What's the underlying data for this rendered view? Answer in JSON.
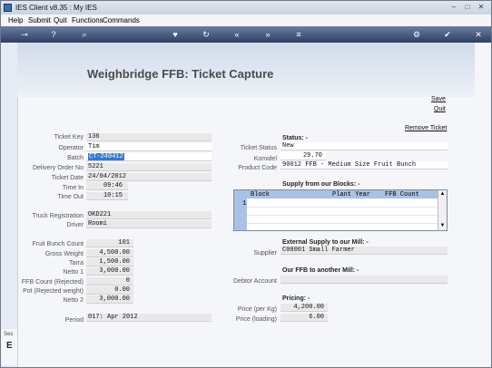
{
  "window": {
    "title": "IES Client v8.35 : My IES",
    "min": "–",
    "max": "□",
    "close": "✕"
  },
  "menu": {
    "help": "Help",
    "submit": "Submit",
    "quit": "Quit",
    "functions": "Functions",
    "commands": "Commands"
  },
  "toolbar": {
    "icons": [
      "key-icon",
      "help-icon",
      "search-icon",
      "heart-icon",
      "refresh-icon",
      "back-icon",
      "forward-icon",
      "menu-icon",
      "gear-icon",
      "check-icon",
      "close-icon"
    ],
    "glyphs": {
      "key": "⊸",
      "help": "?",
      "search": "⌕",
      "heart": "♥",
      "refresh": "↻",
      "back": "«",
      "forward": "»",
      "menu": "≡",
      "gear": "⚙",
      "check": "✔",
      "close": "✕"
    }
  },
  "page": {
    "title": "Weighbridge FFB: Ticket Capture",
    "save": "Save",
    "quit": "Quit",
    "remove_ticket": "Remove Ticket"
  },
  "left": {
    "ticket_key": {
      "label": "Ticket Key",
      "value": "136"
    },
    "operator": {
      "label": "Operator",
      "value": "Tim"
    },
    "batch": {
      "label": "Batch",
      "value": "CT-240412"
    },
    "delivery_order": {
      "label": "Delivery Order No",
      "value": "5221"
    },
    "ticket_date": {
      "label": "Ticket Date",
      "value": "24/04/2012"
    },
    "time_in": {
      "label": "Time In",
      "value": "09:46"
    },
    "time_out": {
      "label": "Time Out",
      "value": "10:15"
    },
    "truck_reg": {
      "label": "Truck Registration",
      "value": "OKD221"
    },
    "driver": {
      "label": "Driver",
      "value": "Roomi"
    },
    "fruit_bunch_count": {
      "label": "Fruit Bunch Count",
      "value": "101"
    },
    "gross_weight": {
      "label": "Gross Weight",
      "value": "4,500.00"
    },
    "tarra": {
      "label": "Tarra",
      "value": "1,500.00"
    },
    "netto1": {
      "label": "Netto 1",
      "value": "3,000.00"
    },
    "ffb_rejected": {
      "label": "FFB Count (Rejected)",
      "value": "0"
    },
    "pot_rejected": {
      "label": "Pot (Rejected weight)",
      "value": "0.00"
    },
    "netto2": {
      "label": "Netto 2",
      "value": "3,000.00"
    },
    "period": {
      "label": "Period",
      "value": "017: Apr 2012"
    }
  },
  "right": {
    "status_header": "Status: -",
    "ticket_status": {
      "label": "Ticket Status",
      "value": "New"
    },
    "komidel": {
      "label": "Komidel",
      "value": "29.70"
    },
    "product_code": {
      "label": "Product Code",
      "value": "90012 FFB - Medium Size Fruit Bunch"
    },
    "supply_header": "Supply from our Blocks: -",
    "grid": {
      "col_block": "Block",
      "col_plant_year": "Plant Year",
      "col_ffb_count": "FFB Count",
      "row_number": "1",
      "scroll_up": "▲",
      "scroll_down": "▼"
    },
    "external_header": "External Supply to our Mill: -",
    "supplier": {
      "label": "Supplier",
      "value": "C00001 Small Farmer"
    },
    "our_ffb_header": "Our FFB to another Mill: -",
    "debtor": {
      "label": "Debtor Account",
      "value": ""
    },
    "pricing_header": "Pricing: -",
    "price_per_kg": {
      "label": "Price (per Kg)",
      "value": "4,200.00"
    },
    "price_loading": {
      "label": "Price (loading)",
      "value": "6.00"
    }
  },
  "bottom": {
    "ses": "Ses",
    "big": "E"
  },
  "colors": {
    "toolbar": "#3b4d73",
    "batch_highlight": "#3a78c9",
    "grid_header": "#a9c2e4"
  }
}
